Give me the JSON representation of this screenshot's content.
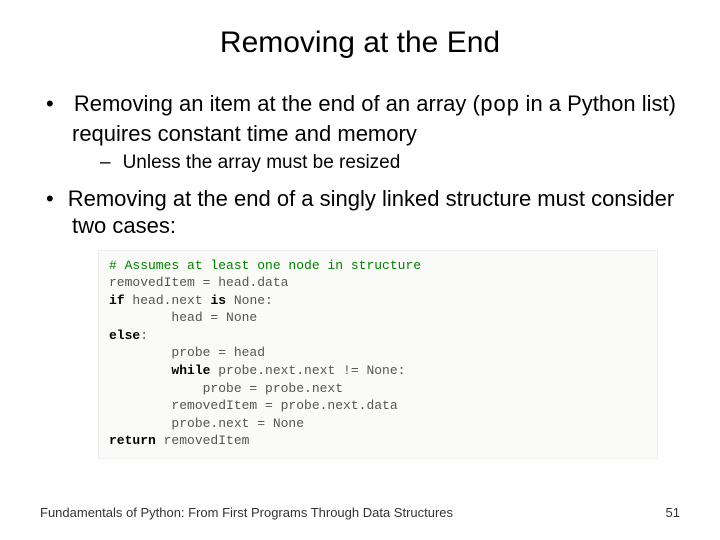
{
  "title": "Removing at the End",
  "bullets": {
    "b1_prefix": "Removing an item at the end of an array (",
    "b1_code": "pop",
    "b1_suffix": " in a Python list) requires constant time and memory",
    "b1_sub1": "Unless the array must be resized",
    "b2": "Removing at the end of a singly linked structure must consider two cases:"
  },
  "code": {
    "l1_comment": "# Assumes at least one node in structure",
    "l2": "removedItem = head.data",
    "l3_kw": "if",
    "l3_rest": " head.next ",
    "l3_is": "is",
    "l3_none": " None:",
    "l4": "        head = None",
    "l5_kw": "else",
    "l5_rest": ":",
    "l6": "        probe = head",
    "l7_kw": "        while",
    "l7_rest": " probe.next.next != None:",
    "l8": "            probe = probe.next",
    "l9": "        removedItem = probe.next.data",
    "l10": "        probe.next = None",
    "l11_kw": "return",
    "l11_rest": " removedItem"
  },
  "footer": {
    "text": "Fundamentals of Python: From First Programs Through Data Structures",
    "page": "51"
  }
}
